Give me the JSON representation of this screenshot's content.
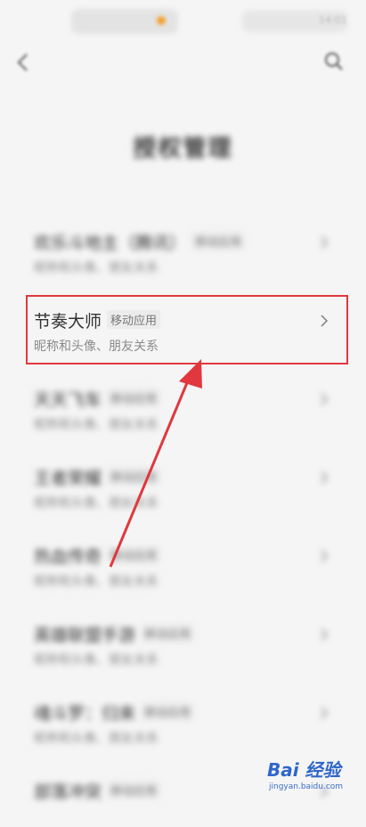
{
  "status_bar": {
    "time": "14:01"
  },
  "header": {
    "title": "授权管理"
  },
  "apps": [
    {
      "name": "欢乐斗地主（腾讯）",
      "tag": "移动应用",
      "desc": "昵称和头像、朋友关系"
    },
    {
      "name": "节奏大师",
      "tag": "移动应用",
      "desc": "昵称和头像、朋友关系"
    },
    {
      "name": "天天飞车",
      "tag": "移动应用",
      "desc": "昵称和头像、朋友关系"
    },
    {
      "name": "王者荣耀",
      "tag": "移动应用",
      "desc": "昵称和头像、朋友关系"
    },
    {
      "name": "热血传奇",
      "tag": "移动应用",
      "desc": "昵称和头像、朋友关系"
    },
    {
      "name": "英雄联盟手游",
      "tag": "移动应用",
      "desc": "昵称和头像、朋友关系"
    },
    {
      "name": "魂斗罗：归来",
      "tag": "移动应用",
      "desc": "昵称和头像、朋友关系"
    },
    {
      "name": "部落冲突",
      "tag": "移动应用",
      "desc": ""
    }
  ],
  "watermark": {
    "text": "Bai 经验",
    "sub": "jingyan.baidu.com"
  },
  "colors": {
    "highlight": "#e0383e",
    "arrow": "#e0383e"
  }
}
